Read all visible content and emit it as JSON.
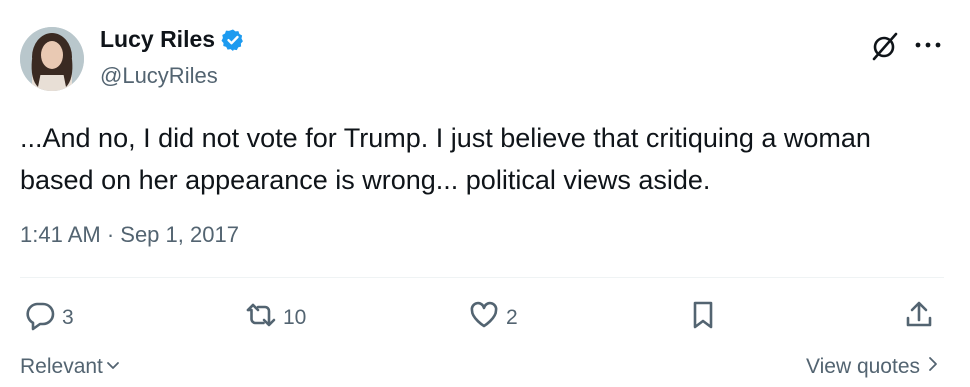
{
  "author": {
    "display_name": "Lucy Riles",
    "handle": "@LucyRiles",
    "verified": true
  },
  "tweet": {
    "text": "...And no, I did not vote for Trump. I just believe that critiquing a woman based on her appearance is wrong... political views aside.",
    "timestamp": "1:41 AM · Sep 1, 2017"
  },
  "actions": {
    "replies": "3",
    "retweets": "10",
    "likes": "2"
  },
  "footer": {
    "sort_label": "Relevant",
    "view_quotes_label": "View quotes"
  },
  "colors": {
    "verified_blue": "#1d9bf0",
    "text": "#0f1419",
    "secondary": "#536471"
  }
}
